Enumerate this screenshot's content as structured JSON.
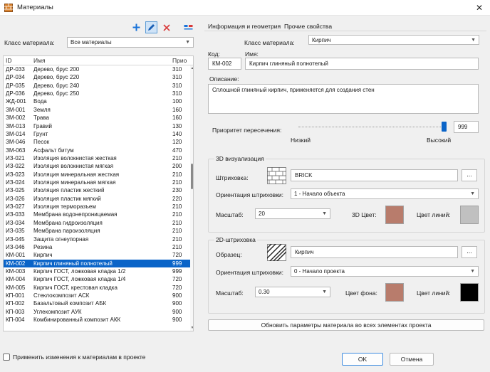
{
  "window": {
    "title": "Материалы",
    "close_glyph": "✕"
  },
  "toolbar": {
    "add": "plus-icon",
    "edit": "pencil-icon",
    "delete": "close-icon",
    "extra": "settings-icon"
  },
  "filter": {
    "label": "Класс материала:",
    "value": "Все материалы"
  },
  "table": {
    "headers": [
      "ID",
      "Имя",
      "Прио"
    ],
    "rows": [
      [
        "ДР-033",
        "Дерево, брус 200",
        "310"
      ],
      [
        "ДР-034",
        "Дерево, брус 220",
        "310"
      ],
      [
        "ДР-035",
        "Дерево, брус 240",
        "310"
      ],
      [
        "ДР-036",
        "Дерево, брус 250",
        "310"
      ],
      [
        "ЖД-001",
        "Вода",
        "100"
      ],
      [
        "ЗМ-001",
        "Земля",
        "160"
      ],
      [
        "ЗМ-002",
        "Трава",
        "160"
      ],
      [
        "ЗМ-013",
        "Гравий",
        "130"
      ],
      [
        "ЗМ-014",
        "Грунт",
        "140"
      ],
      [
        "ЗМ-046",
        "Песок",
        "120"
      ],
      [
        "ЗМ-063",
        "Асфальт битум",
        "470"
      ],
      [
        "ИЗ-021",
        "Изоляция волокнистая жесткая",
        "210"
      ],
      [
        "ИЗ-022",
        "Изоляция волокнистая мягкая",
        "200"
      ],
      [
        "ИЗ-023",
        "Изоляция минеральная жесткая",
        "210"
      ],
      [
        "ИЗ-024",
        "Изоляция минеральная мягкая",
        "210"
      ],
      [
        "ИЗ-025",
        "Изоляция пластик жесткий",
        "230"
      ],
      [
        "ИЗ-026",
        "Изоляция пластик мягкий",
        "220"
      ],
      [
        "ИЗ-027",
        "Изоляция терморазъем",
        "210"
      ],
      [
        "ИЗ-033",
        "Мембрана водонепроницаемая",
        "210"
      ],
      [
        "ИЗ-034",
        "Мембрана гидроизоляция",
        "210"
      ],
      [
        "ИЗ-035",
        "Мембрана пароизоляция",
        "210"
      ],
      [
        "ИЗ-045",
        "Защита огнеупорная",
        "210"
      ],
      [
        "ИЗ-046",
        "Резина",
        "210"
      ],
      [
        "КМ-001",
        "Кирпич",
        "720"
      ],
      [
        "КМ-002",
        "Кирпич глиняный полнотелый",
        "999"
      ],
      [
        "КМ-003",
        "Кирпич ГОСТ, ложковая кладка 1/2",
        "999"
      ],
      [
        "КМ-004",
        "Кирпич ГОСТ, ложковая кладка 1/4",
        "720"
      ],
      [
        "КМ-005",
        "Кирпич ГОСТ, крестовая кладка",
        "720"
      ],
      [
        "КП-001",
        "Стеклокомпозит АСК",
        "900"
      ],
      [
        "КП-002",
        "Базальтовый композит АБК",
        "900"
      ],
      [
        "КП-003",
        "Углекомпозит АУК",
        "900"
      ],
      [
        "КП-004",
        "Комбинированный композит АКК",
        "900"
      ]
    ],
    "selected_index": 24
  },
  "apply_changes_label": "Применить изменения к материалам в проекте",
  "tabs": [
    "Информация и геометрия",
    "Прочие свойства"
  ],
  "props": {
    "class_label": "Класс материала:",
    "class_value": "Кирпич",
    "code_label": "Код:",
    "code_value": "КМ-002",
    "name_label": "Имя:",
    "name_value": "Кирпич глиняный полнотелый",
    "desc_label": "Описание:",
    "desc_value": "Сплошной глиняный кирпич, применяется для создания стен",
    "priority_label": "Приоритет пересечения:",
    "priority_value": "999",
    "low_label": "Низкий",
    "high_label": "Высокий",
    "priority_fraction": 1.0
  },
  "viz3d": {
    "title": "3D визуализация",
    "hatch_label": "Штриховка:",
    "hatch_value": "BRICK",
    "orient_label": "Ориентация штриховки:",
    "orient_value": "1 - Начало объекта",
    "scale_label": "Масштаб:",
    "scale_value": "20",
    "color3d_label": "3D Цвет:",
    "color3d": "#b87c6c",
    "line_color_label": "Цвет линий:",
    "line_color": "#c0c0c0",
    "browse_label": "..."
  },
  "hatch2d": {
    "title": "2D-штриховка",
    "sample_label": "Образец:",
    "sample_value": "Кирпич",
    "orient_label": "Ориентация штриховки:",
    "orient_value": "0 - Начало проекта",
    "scale_label": "Масштаб:",
    "scale_value": "0.30",
    "bg_label": "Цвет фона:",
    "bg_color": "#b87c6c",
    "line_color_label": "Цвет линий:",
    "line_color": "#000000",
    "browse_label": "..."
  },
  "update_button": "Обновить параметры материала во всех элементах проекта",
  "ok_button": "OK",
  "cancel_button": "Отмена",
  "colors": {
    "selection": "#0a64c8",
    "add_icon": "#1a73d9",
    "delete_icon": "#d83a3a"
  }
}
